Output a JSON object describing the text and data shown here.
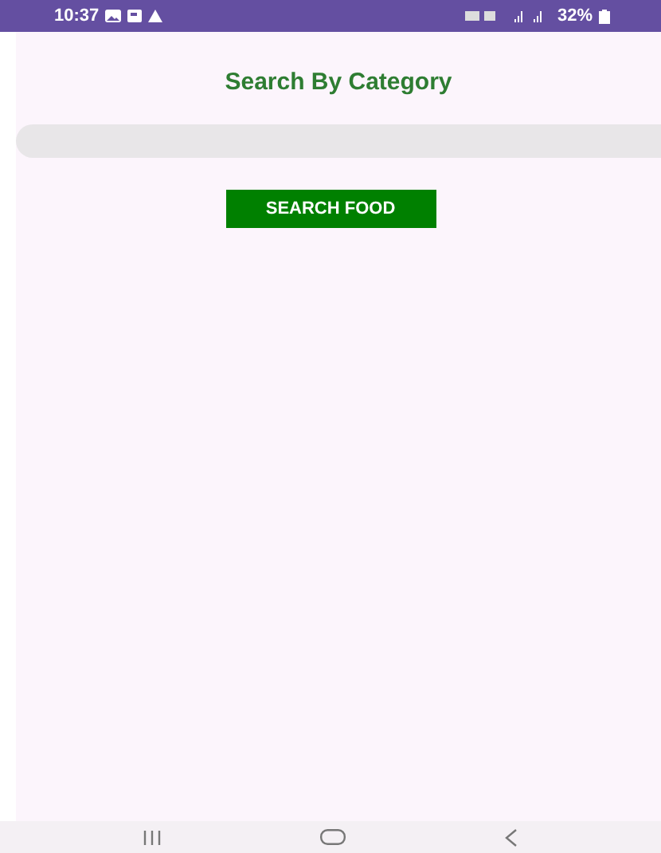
{
  "status_bar": {
    "time": "10:37",
    "battery": "32%"
  },
  "title": "Search By Category",
  "button": {
    "label": "SEARCH FOOD"
  }
}
